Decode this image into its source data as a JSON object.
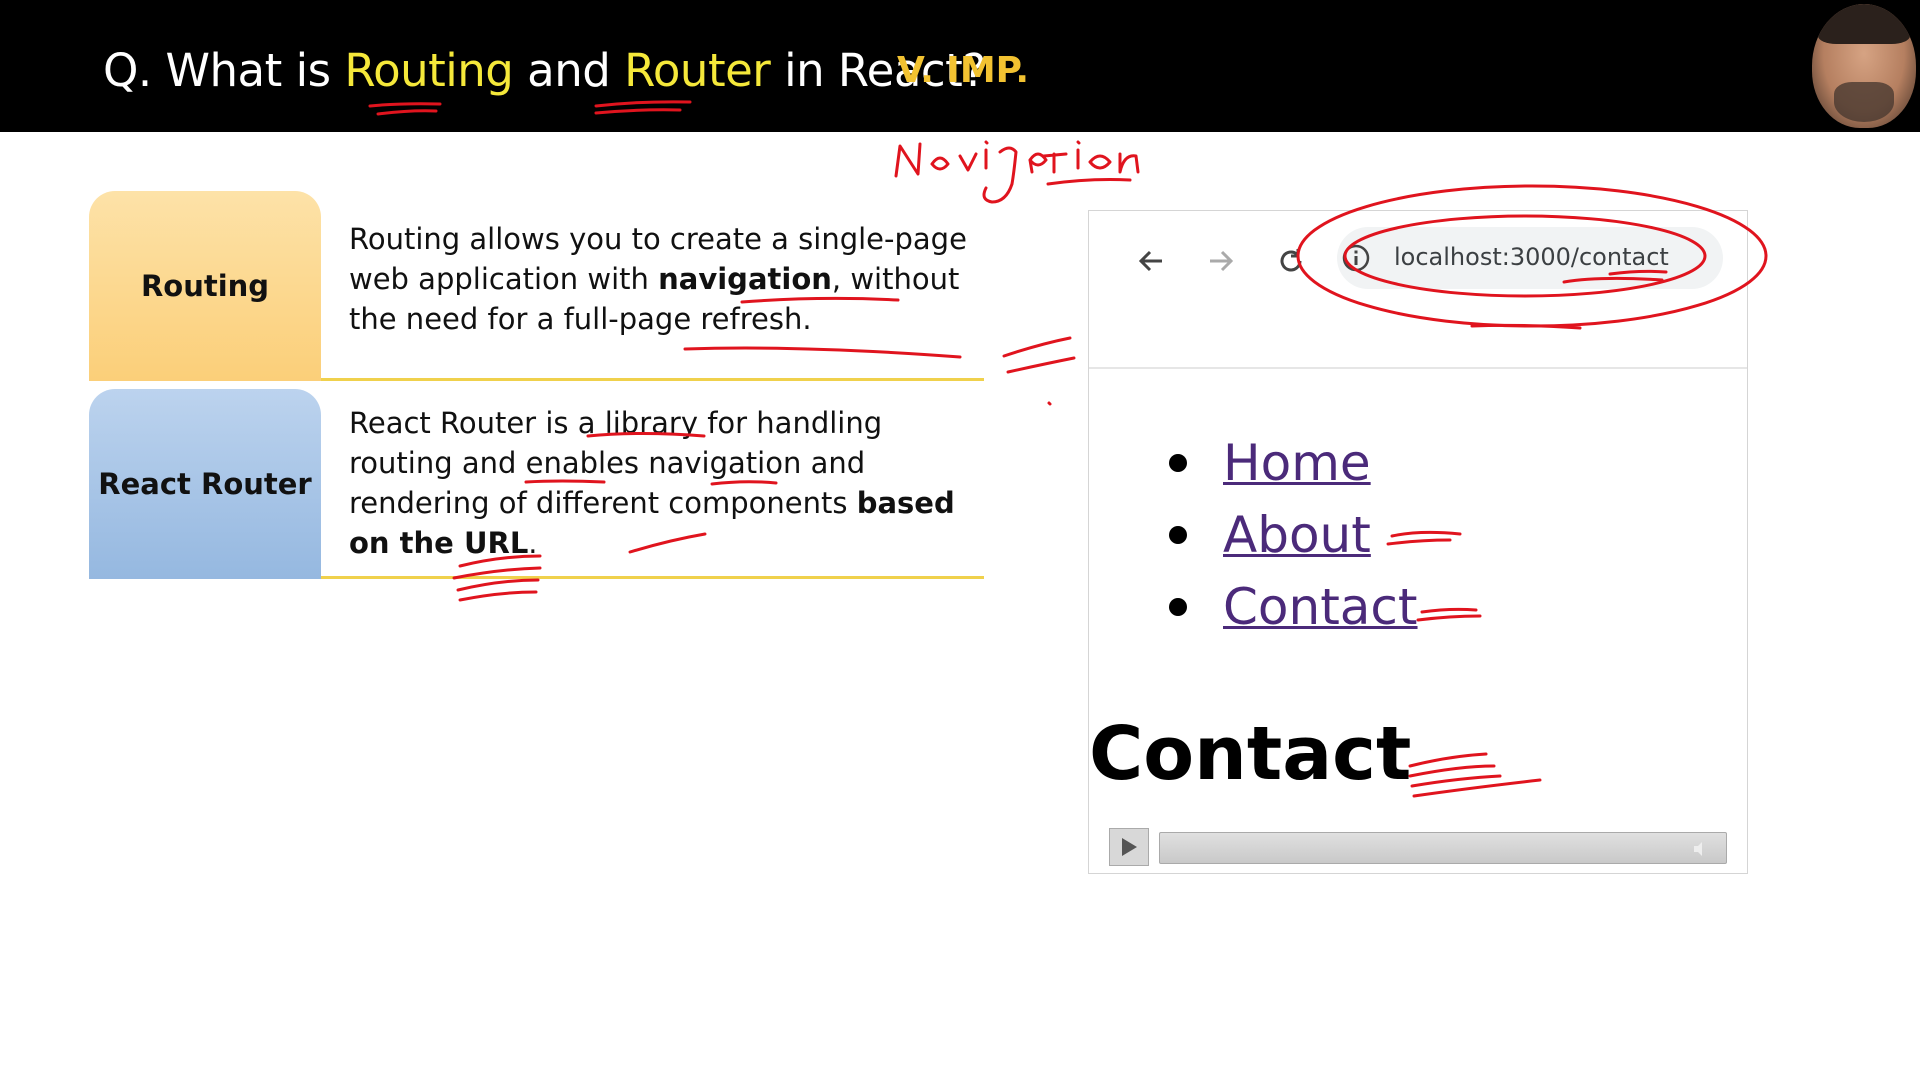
{
  "slide": {
    "title_prefix": "Q. What is ",
    "title_word1": "Routing",
    "title_mid": " and ",
    "title_word2": "Router",
    "title_suffix": " in React?",
    "badge": "V. IMP."
  },
  "rows": [
    {
      "label": "Routing",
      "desc_1": "Routing allows you to create a single-page web application with ",
      "desc_bold": "navigation",
      "desc_2": ", without the need for a full-page refresh.",
      "color": "#fcd78c"
    },
    {
      "label": "React Router",
      "desc_1": "React Router is a library for handling routing and enables navigation and rendering of different components ",
      "desc_bold": "based on the URL",
      "desc_2": ".",
      "color": "#a8c6e8"
    }
  ],
  "browser": {
    "url": "localhost:3000/contact",
    "links": [
      "Home",
      "About",
      "Contact"
    ],
    "heading": "Contact"
  },
  "annotation": {
    "handwritten": "Navigation",
    "ink_color": "#e0141e"
  }
}
